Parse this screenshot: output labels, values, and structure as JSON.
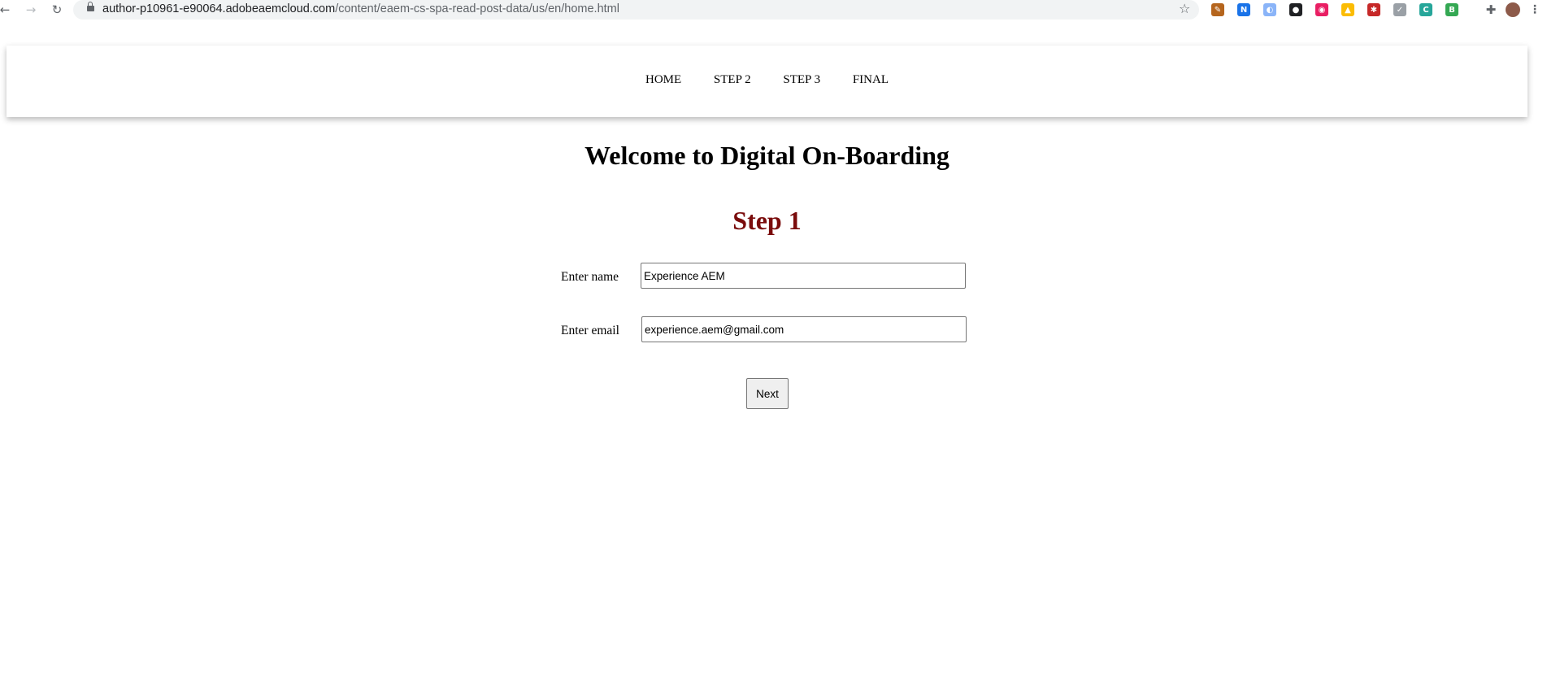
{
  "browser": {
    "url_host": "author-p10961-e90064.adobeaemcloud.com",
    "url_path": "/content/eaem-cs-spa-read-post-data/us/en/home.html",
    "extensions": [
      {
        "name": "pen-extension-icon",
        "color": "#b5651d",
        "glyph": "✎"
      },
      {
        "name": "n-extension-icon",
        "color": "#1a73e8",
        "glyph": "N"
      },
      {
        "name": "compass-extension-icon",
        "color": "#8ab4f8",
        "glyph": "◐"
      },
      {
        "name": "spy-extension-icon",
        "color": "#202124",
        "glyph": "●"
      },
      {
        "name": "eye-extension-icon",
        "color": "#e91e63",
        "glyph": "◉"
      },
      {
        "name": "drive-extension-icon",
        "color": "#fbbc04",
        "glyph": "▲"
      },
      {
        "name": "red-extension-icon",
        "color": "#c62828",
        "glyph": "✱"
      },
      {
        "name": "feather-extension-icon",
        "color": "#9aa0a6",
        "glyph": "✓"
      },
      {
        "name": "c-extension-icon",
        "color": "#26a69a",
        "glyph": "C"
      },
      {
        "name": "b-extension-icon",
        "color": "#34a853",
        "glyph": "B"
      }
    ]
  },
  "nav": {
    "items": [
      "HOME",
      "STEP 2",
      "STEP 3",
      "FINAL"
    ]
  },
  "page": {
    "title": "Welcome to Digital On-Boarding",
    "step": "Step 1"
  },
  "form": {
    "name_label": "Enter name",
    "name_value": "Experience AEM",
    "email_label": "Enter email",
    "email_value": "experience.aem@gmail.com",
    "next_label": "Next"
  }
}
